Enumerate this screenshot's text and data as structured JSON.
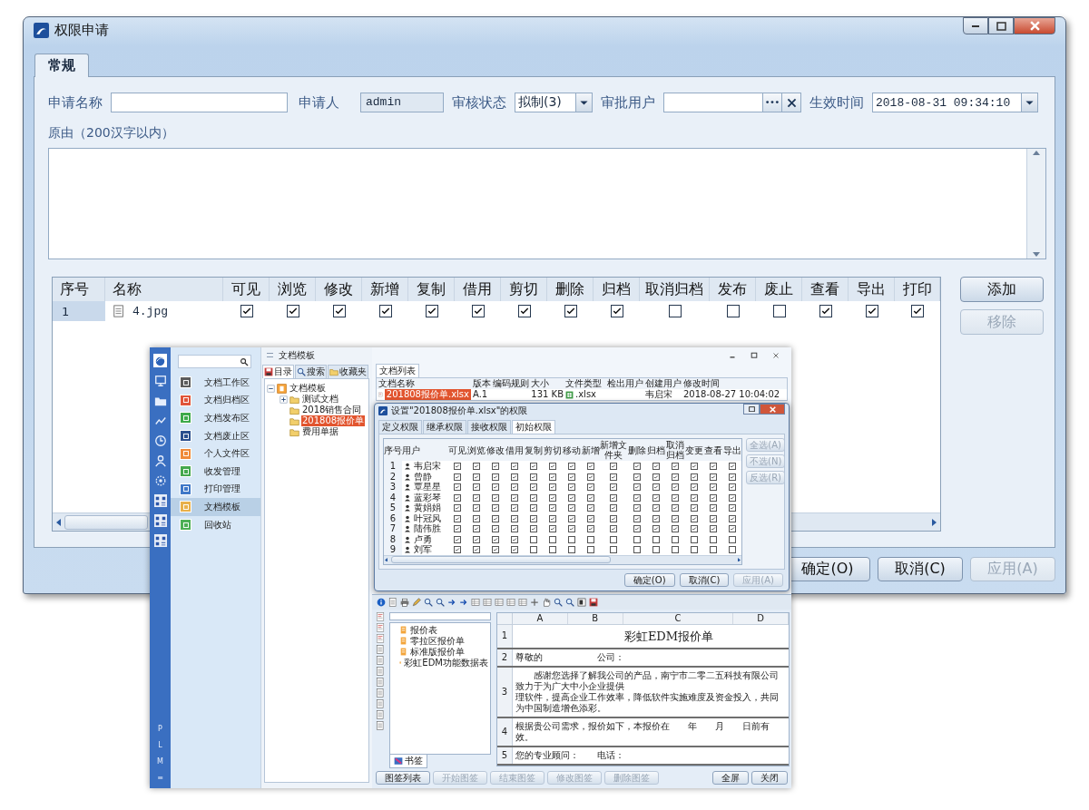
{
  "window": {
    "title": "权限申请"
  },
  "tabs": [
    {
      "label": "常规",
      "selected": true
    }
  ],
  "form": {
    "fields": [
      {
        "kind": "text",
        "label": "申请名称"
      },
      {
        "kind": "readonly",
        "label": "申请人",
        "value": "admin"
      },
      {
        "kind": "select",
        "label": "审核状态",
        "value": "拟制(3)"
      },
      {
        "kind": "picker",
        "label": "审批用户"
      },
      {
        "kind": "datetime",
        "label": "生效时间",
        "value": "2018-08-31 09:34:10"
      }
    ],
    "reason_label": "原由（200汉字以内）"
  },
  "table": {
    "columns": [
      "序号",
      "名称",
      "可见",
      "浏览",
      "修改",
      "新增",
      "复制",
      "借用",
      "剪切",
      "删除",
      "归档",
      "取消归档",
      "发布",
      "废止",
      "查看",
      "导出",
      "打印"
    ],
    "rows": [
      {
        "index": "1",
        "name": "4.jpg",
        "perms": [
          true,
          true,
          true,
          true,
          true,
          true,
          true,
          true,
          true,
          false,
          false,
          false,
          true,
          true,
          true
        ]
      }
    ]
  },
  "side_buttons": [
    {
      "label": "添加",
      "disabled": false
    },
    {
      "label": "移除",
      "disabled": true
    }
  ],
  "footer_buttons": [
    {
      "label": "确定(O)",
      "disabled": false
    },
    {
      "label": "取消(C)",
      "disabled": false
    },
    {
      "label": "应用(A)",
      "disabled": true
    }
  ],
  "inset": {
    "rail_letters": [
      "P",
      "L",
      "M",
      "≡"
    ],
    "nav": [
      {
        "label": "文档工作区",
        "color": "#5c5c5c",
        "selected": false
      },
      {
        "label": "文档归档区",
        "color": "#e0553a",
        "selected": false
      },
      {
        "label": "文档发布区",
        "color": "#3daa4a",
        "selected": false
      },
      {
        "label": "文档废止区",
        "color": "#2a4f8e",
        "selected": false
      },
      {
        "label": "个人文件区",
        "color": "#ef8a3a",
        "selected": false
      },
      {
        "label": "收发管理",
        "color": "#45a84e",
        "selected": false
      },
      {
        "label": "打印管理",
        "color": "#3f78c8",
        "selected": false
      },
      {
        "label": "文档模板",
        "color": "#e8b04a",
        "selected": true
      },
      {
        "label": "回收站",
        "color": "#4caf55",
        "selected": false
      }
    ],
    "panel": {
      "title": "文档模板",
      "tabs": [
        {
          "label": "目录",
          "selected": true
        },
        {
          "label": "搜索",
          "selected": false
        },
        {
          "label": "收藏夹",
          "selected": false
        }
      ],
      "tree": [
        {
          "label": "文档模板",
          "selected": false,
          "expanded": true,
          "children": [
            {
              "label": "测试文档",
              "selected": false,
              "expanded": false
            },
            {
              "label": "2018销售合同",
              "selected": false
            },
            {
              "label": "201808报价单",
              "selected": true
            },
            {
              "label": "费用单据",
              "selected": false
            }
          ]
        }
      ]
    },
    "list": {
      "tab": "文档列表",
      "columns": [
        "文档名称",
        "版本",
        "编码规则",
        "大小",
        "文件类型",
        "检出用户",
        "创建用户",
        "修改时间"
      ],
      "rows": [
        {
          "name": "201808报价单.xlsx",
          "version": "A.1",
          "size": "131 KB",
          "type": ".xlsx",
          "creator": "韦启宋",
          "modified": "2018-08-27 10:04:02",
          "selected": true
        }
      ]
    },
    "permission_dialog": {
      "title": "设置\"201808报价单.xlsx\"的权限",
      "tabs": [
        {
          "label": "定义权限",
          "selected": false
        },
        {
          "label": "继承权限",
          "selected": false
        },
        {
          "label": "接收权限",
          "selected": false
        },
        {
          "label": "初始权限",
          "selected": true
        }
      ],
      "columns": [
        "序号",
        "用户",
        "可见",
        "浏览",
        "修改",
        "借用",
        "复制",
        "剪切",
        "移动",
        "新增",
        "新增文件夹",
        "删除",
        "归档",
        "取消归档",
        "变更",
        "查看",
        "导出"
      ],
      "rows": [
        {
          "index": "1",
          "user": "韦启宋",
          "perms": [
            true,
            true,
            true,
            true,
            true,
            true,
            true,
            true,
            true,
            true,
            true,
            true,
            true,
            true,
            true
          ]
        },
        {
          "index": "2",
          "user": "曾静",
          "perms": [
            true,
            true,
            true,
            true,
            true,
            true,
            true,
            true,
            true,
            true,
            true,
            true,
            true,
            true,
            true
          ]
        },
        {
          "index": "3",
          "user": "覃星星",
          "perms": [
            true,
            true,
            true,
            true,
            true,
            true,
            true,
            true,
            true,
            true,
            true,
            true,
            true,
            true,
            true
          ]
        },
        {
          "index": "4",
          "user": "蓝彩琴",
          "perms": [
            true,
            true,
            true,
            true,
            true,
            true,
            true,
            true,
            true,
            true,
            true,
            true,
            true,
            true,
            true
          ]
        },
        {
          "index": "5",
          "user": "黄娟娟",
          "perms": [
            true,
            true,
            true,
            true,
            true,
            true,
            true,
            true,
            true,
            true,
            true,
            true,
            true,
            true,
            true
          ]
        },
        {
          "index": "6",
          "user": "叶冠风",
          "perms": [
            true,
            true,
            true,
            true,
            true,
            true,
            true,
            true,
            true,
            true,
            true,
            true,
            true,
            true,
            true
          ]
        },
        {
          "index": "7",
          "user": "陆伟胜",
          "perms": [
            true,
            true,
            true,
            true,
            true,
            true,
            true,
            true,
            true,
            true,
            true,
            true,
            true,
            true,
            true
          ]
        },
        {
          "index": "8",
          "user": "卢勇",
          "perms": [
            true,
            true,
            true,
            true,
            false,
            false,
            false,
            false,
            false,
            false,
            false,
            false,
            false,
            false,
            false
          ]
        },
        {
          "index": "9",
          "user": "刘军",
          "perms": [
            true,
            true,
            true,
            true,
            false,
            false,
            false,
            false,
            false,
            false,
            false,
            false,
            false,
            false,
            false
          ]
        }
      ],
      "side_buttons": [
        {
          "label": "全选(A)",
          "disabled": true
        },
        {
          "label": "不选(N)",
          "disabled": true
        },
        {
          "label": "反选(R)",
          "disabled": true
        }
      ],
      "buttons": [
        {
          "label": "确定(O)",
          "disabled": false
        },
        {
          "label": "取消(C)",
          "disabled": false
        },
        {
          "label": "应用(A)",
          "disabled": true
        }
      ]
    },
    "viewer": {
      "outline": [
        "报价表",
        "零拉区报价单",
        "标准版报价单",
        "彩虹EDM功能数据表"
      ],
      "outline_tab": "书签",
      "columns": [
        "A",
        "B",
        "C",
        "D"
      ],
      "rows": [
        {
          "number": "1",
          "kind": "title",
          "texts": [
            "彩虹EDM报价单"
          ]
        },
        {
          "number": "2",
          "kind": "pair",
          "texts": [
            "尊敬的",
            "公司："
          ]
        },
        {
          "number": "3",
          "kind": "paragraph",
          "texts": [
            "感谢您选择了解我公司的产品，南宁市二零二五科技有限公司致力于为广大中小企业提供",
            "理软件，提高企业工作效率，降低软件实施难度及资金投入，共同为中国制造增色添彩。"
          ]
        },
        {
          "number": "4",
          "kind": "text",
          "texts": [
            "根据贵公司需求，报价如下，本报价在　　年　　月　　日前有效。"
          ]
        },
        {
          "number": "5",
          "kind": "pair",
          "texts": [
            "您的专业顾问：",
            "电话："
          ]
        }
      ],
      "buttons": [
        {
          "label": "图签列表",
          "disabled": false
        },
        {
          "label": "开始图签",
          "disabled": true
        },
        {
          "label": "结束图签",
          "disabled": true
        },
        {
          "label": "修改图签",
          "disabled": true
        },
        {
          "label": "删除图签",
          "disabled": true
        }
      ],
      "right_buttons": [
        {
          "label": "全屏",
          "disabled": false
        },
        {
          "label": "关闭",
          "disabled": false
        }
      ]
    }
  }
}
